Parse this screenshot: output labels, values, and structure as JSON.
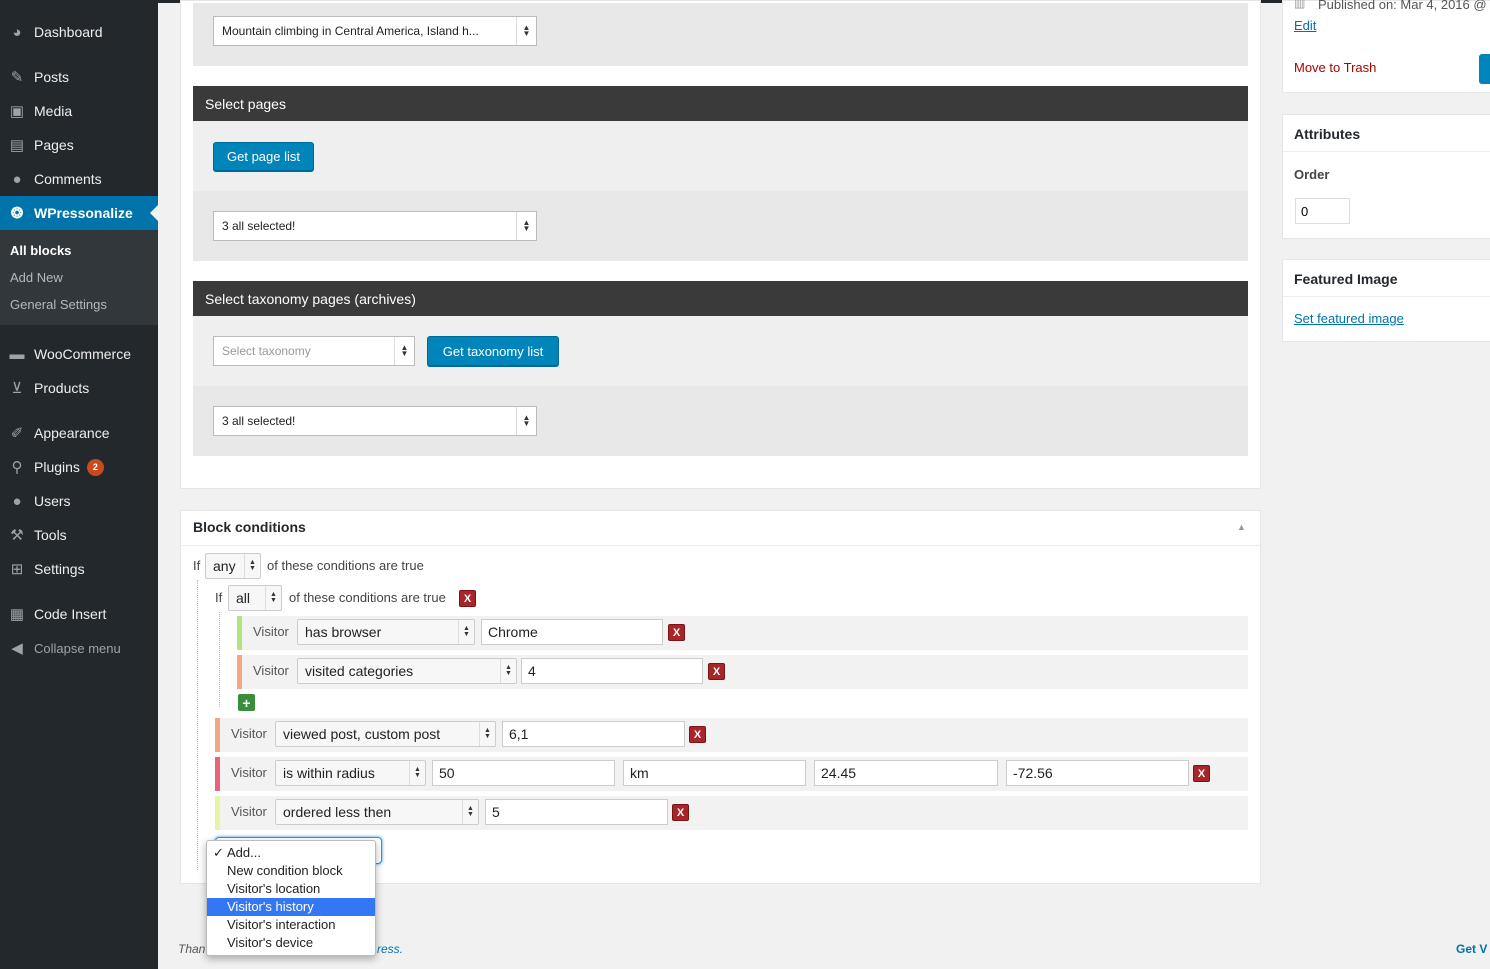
{
  "sidebar": {
    "items": [
      {
        "label": "Dashboard",
        "icon": "dashboard-icon",
        "glyph": "◕"
      },
      {
        "label": "Posts",
        "icon": "pin-icon",
        "glyph": "✎"
      },
      {
        "label": "Media",
        "icon": "media-icon",
        "glyph": "▣"
      },
      {
        "label": "Pages",
        "icon": "pages-icon",
        "glyph": "▤"
      },
      {
        "label": "Comments",
        "icon": "comments-icon",
        "glyph": "●"
      },
      {
        "label": "WPressonalize",
        "icon": "wpressonalize-icon",
        "glyph": "❂"
      },
      {
        "label": "WooCommerce",
        "icon": "woo-icon",
        "glyph": "▬"
      },
      {
        "label": "Products",
        "icon": "cart-icon",
        "glyph": "⊻"
      },
      {
        "label": "Appearance",
        "icon": "brush-icon",
        "glyph": "✐"
      },
      {
        "label": "Plugins",
        "icon": "plugin-icon",
        "glyph": "⚲",
        "badge": "2"
      },
      {
        "label": "Users",
        "icon": "user-icon",
        "glyph": "●"
      },
      {
        "label": "Tools",
        "icon": "wrench-icon",
        "glyph": "⚒"
      },
      {
        "label": "Settings",
        "icon": "settings-icon",
        "glyph": "⊞"
      },
      {
        "label": "Code Insert",
        "icon": "code-icon",
        "glyph": "▦"
      }
    ],
    "submenu": [
      "All blocks",
      "Add New",
      "General Settings"
    ],
    "collapse": "Collapse menu",
    "collapse_glyph": "◀"
  },
  "top": {
    "post_select": "Mountain climbing in Central America, Island h..."
  },
  "select_pages": {
    "title": "Select pages",
    "button": "Get page list",
    "select": "3 all selected!"
  },
  "select_taxonomy": {
    "title": "Select taxonomy pages (archives)",
    "placeholder": "Select taxonomy",
    "button": "Get taxonomy list",
    "select": "3 all selected!"
  },
  "block_conditions": {
    "title": "Block conditions",
    "collapse_glyph": "▲",
    "if_label": "If",
    "outer_mode": "any",
    "outer_text": "of these conditions are true",
    "inner_mode": "all",
    "inner_text": "of these conditions are true",
    "visitor_label": "Visitor",
    "rows": [
      {
        "op": "has browser",
        "value": "Chrome",
        "color": "#b5e27b"
      },
      {
        "op": "visited categories",
        "value": "4",
        "color": "#f4a582"
      },
      {
        "op": "viewed post, custom post",
        "value": "6,1",
        "color": "#f4a582"
      },
      {
        "op": "is within radius",
        "v1": "50",
        "v2": "km",
        "v3": "24.45",
        "v4": "-72.56",
        "color": "#e8627a"
      },
      {
        "op": "ordered less then",
        "value": "5",
        "color": "#e8f5a0"
      }
    ],
    "remove_glyph": "X",
    "add_glyph": "+"
  },
  "dropdown": {
    "check": "✓",
    "options": [
      "Add...",
      "New condition block",
      "Visitor's location",
      "Visitor's history",
      "Visitor's interaction",
      "Visitor's device"
    ],
    "selected_index": 3
  },
  "right": {
    "published": "Published on: Mar 4, 2016 @",
    "calendar_glyph": "▥",
    "edit": "Edit",
    "trash": "Move to Trash",
    "attributes_title": "Attributes",
    "order_label": "Order",
    "order_value": "0",
    "featured_title": "Featured Image",
    "featured_link": "Set featured image"
  },
  "footer": {
    "left_partial": "Than",
    "mid_partial": "ress.",
    "right_partial": "Get V"
  },
  "colors": {
    "accent": "#0073aa",
    "sidebar": "#23282d",
    "remove": "#a8262a",
    "add": "#3a8d3a"
  }
}
